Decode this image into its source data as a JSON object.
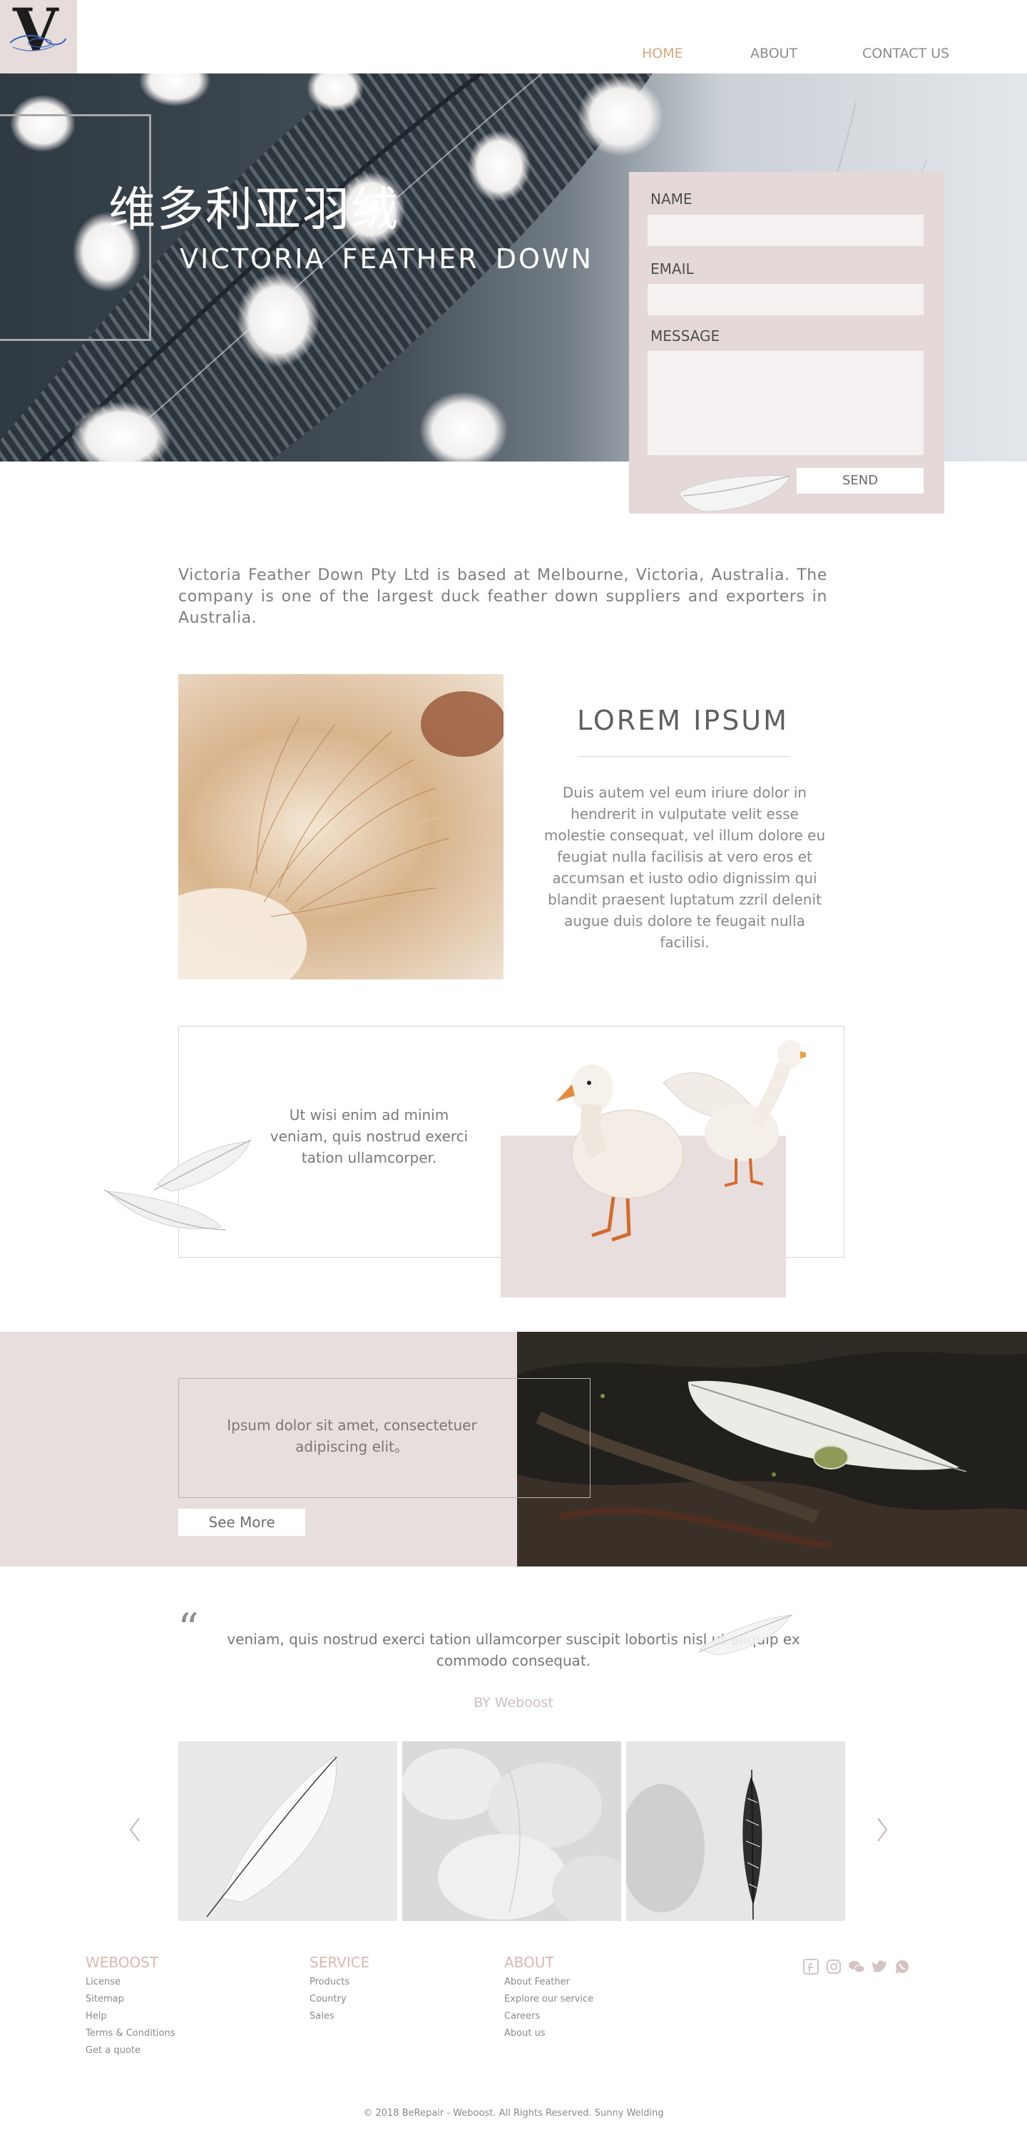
{
  "header": {
    "logo_letter": "V",
    "nav": [
      {
        "label": "HOME",
        "active": true
      },
      {
        "label": "ABOUT",
        "active": false
      },
      {
        "label": "CONTACT US",
        "active": false
      }
    ],
    "accent_color": "#d8a77f"
  },
  "hero": {
    "title_cn": "维多利亚羽绒",
    "title_en": "VICTORIA  FEATHER  DOWN"
  },
  "contact_form": {
    "name_label": "NAME",
    "email_label": "EMAIL",
    "message_label": "MESSAGE",
    "name_value": "",
    "email_value": "",
    "message_value": "",
    "send_label": "SEND"
  },
  "intro": {
    "text": "Victoria Feather Down Pty Ltd is based at Melbourne, Victoria, Australia. The company is one of the largest duck feather down suppliers and exporters in Australia."
  },
  "lorem_section": {
    "title": "LOREM  IPSUM",
    "body": "Duis autem vel eum iriure dolor in hendrerit in vulputate velit esse molestie consequat, vel illum dolore eu feugiat nulla facilisis at vero eros et accumsan et iusto odio dignissim qui blandit praesent luptatum zzril delenit augue duis dolore te feugait nulla facilisi."
  },
  "duck_section": {
    "text": "Ut wisi enim ad minim veniam, quis nostrud exerci tation ullamcorper."
  },
  "band": {
    "text": "Ipsum dolor sit amet, consectetuer adipiscing elit。",
    "button_label": "See More",
    "bg_color": "#e8dedd"
  },
  "testimonial": {
    "quote": "veniam, quis nostrud exerci tation ullamcorper suscipit lobortis nisl ut aliquip ex commodo consequat.",
    "author": "BY  Weboost"
  },
  "footer": {
    "columns": [
      {
        "heading": "WEBOOST",
        "links": [
          "License",
          "Sitemap",
          "Help",
          "Terms  &  Conditions",
          "Get  a  quote"
        ]
      },
      {
        "heading": "SERVICE",
        "links": [
          "Products",
          "Country",
          "Sales"
        ]
      },
      {
        "heading": "ABOUT",
        "links": [
          "About Feather",
          "Explore our service",
          "Careers",
          "About us"
        ]
      }
    ],
    "social_icons": [
      "facebook-icon",
      "instagram-icon",
      "wechat-icon",
      "twitter-icon",
      "whatsapp-icon"
    ],
    "copyright": "© 2018 BeRepair - Weboost. All Rights Reserved. Sunny Welding"
  }
}
